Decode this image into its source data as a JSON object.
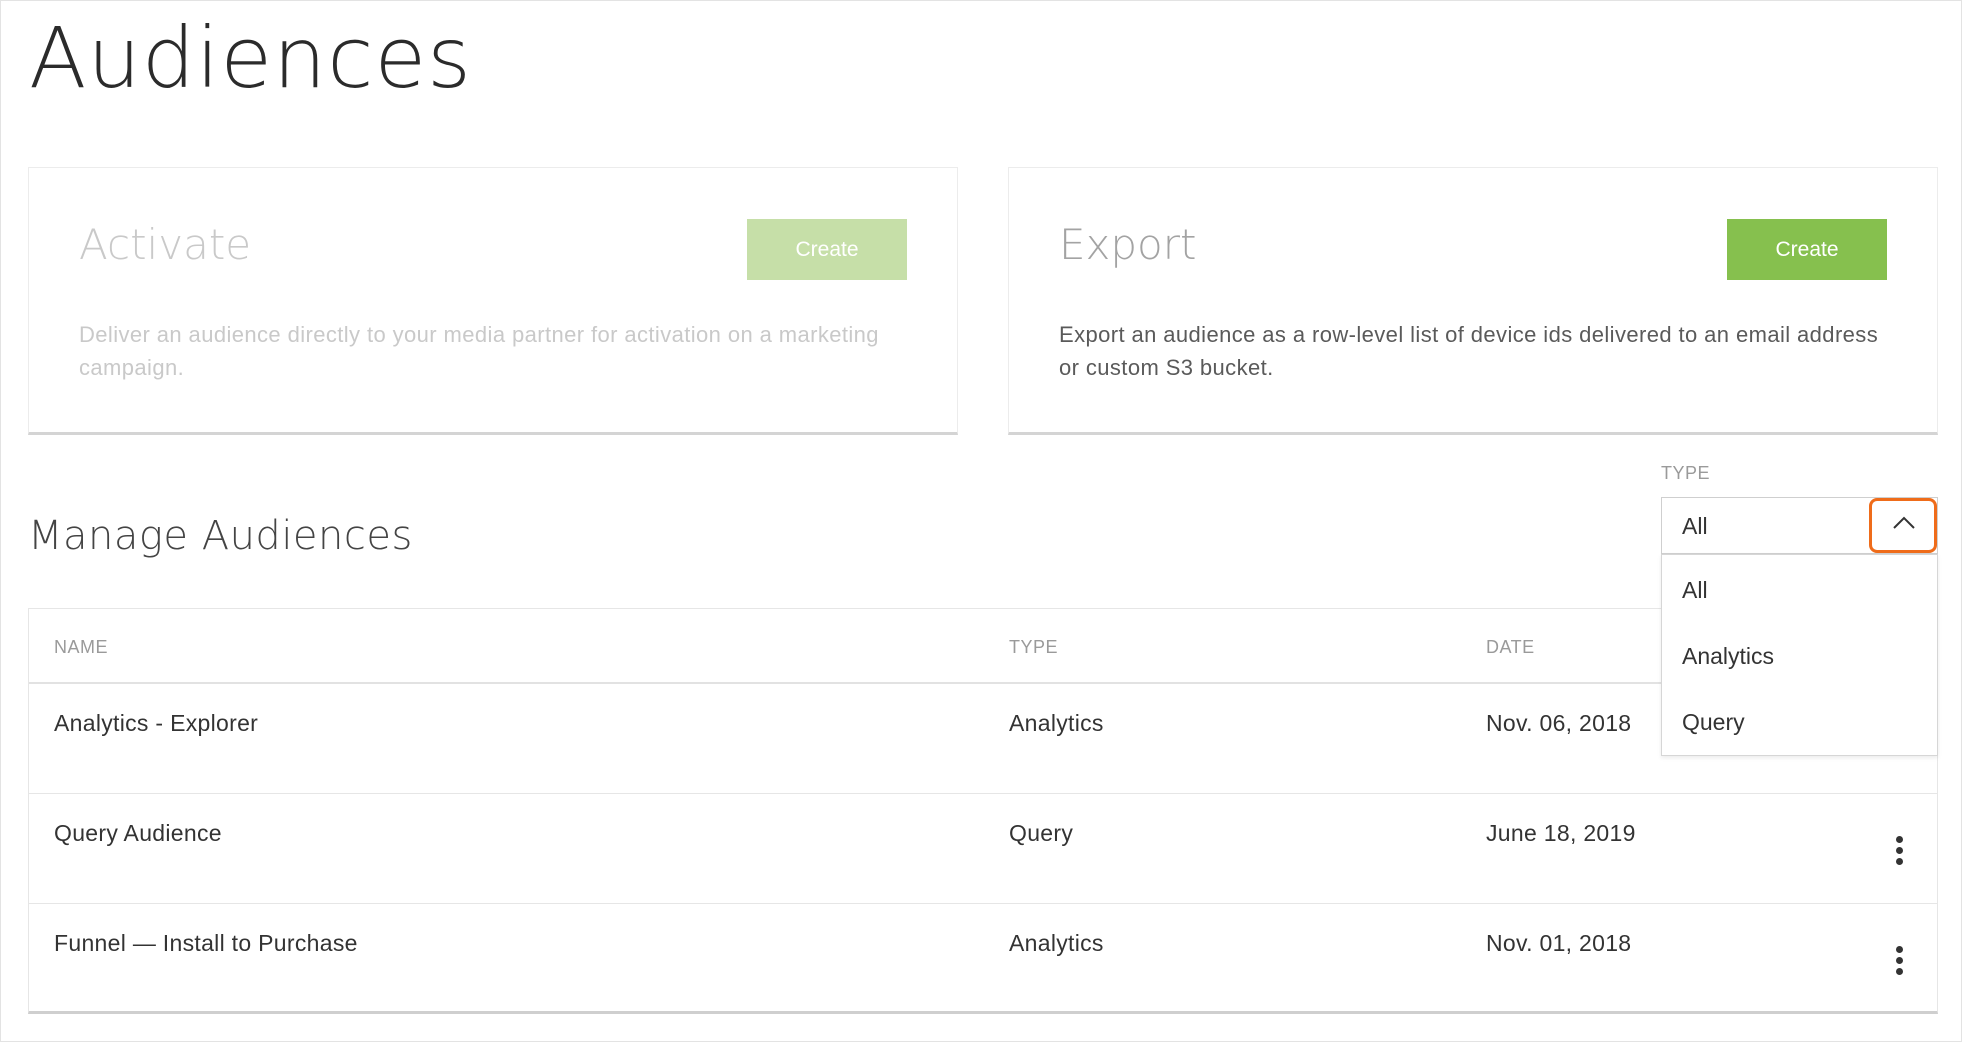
{
  "page": {
    "title": "Audiences"
  },
  "cards": {
    "activate": {
      "title": "Activate",
      "button": "Create",
      "description": "Deliver an audience directly to your media partner for activation on a marketing campaign."
    },
    "export": {
      "title": "Export",
      "button": "Create",
      "description": "Export an audience as a row-level list of device ids delivered to an email address or custom S3 bucket."
    }
  },
  "manage": {
    "title": "Manage Audiences",
    "filter": {
      "label": "TYPE",
      "selected": "All",
      "options": [
        "All",
        "Analytics",
        "Query"
      ]
    },
    "table": {
      "columns": {
        "name": "NAME",
        "type": "TYPE",
        "date": "DATE"
      },
      "rows": [
        {
          "name": "Analytics - Explorer",
          "type": "Analytics",
          "date": "Nov. 06, 2018"
        },
        {
          "name": "Query Audience",
          "type": "Query",
          "date": "June 18, 2019"
        },
        {
          "name": "Funnel — Install to Purchase",
          "type": "Analytics",
          "date": "Nov. 01, 2018"
        }
      ]
    }
  },
  "colors": {
    "accent_green": "#86c04e",
    "disabled_green": "#c6dfa8",
    "highlight_orange": "#ef6c1a"
  },
  "icons": {
    "toggle": "chevron-up-icon",
    "row_menu": "more-vertical-icon"
  }
}
